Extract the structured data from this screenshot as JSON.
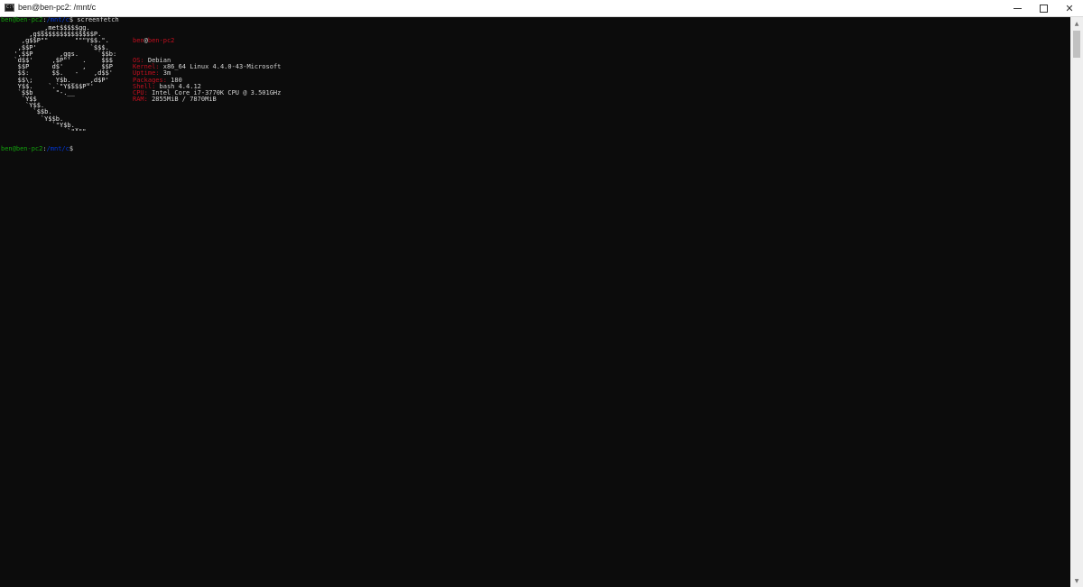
{
  "window": {
    "title": "ben@ben-pc2: /mnt/c",
    "icon": "console-icon",
    "icon_glyph": "C:\\",
    "controls": {
      "minimize_icon": "minimize-icon",
      "maximize_icon": "maximize-icon",
      "close_icon": "close-icon",
      "close_glyph": "✕"
    }
  },
  "colors": {
    "prompt_user": "#13a10e",
    "prompt_path": "#0037da",
    "label": "#c50f1f",
    "logo": "#e8e8e8",
    "logo_accent": "#c50f1f",
    "text": "#c0c0c0",
    "background": "#0c0c0c"
  },
  "prompt1": {
    "user_host": "ben@ben-pc2",
    "colon": ":",
    "path": "/mnt/c",
    "symbol": "$",
    "command": " screenfetch"
  },
  "logo": [
    "         _,met$$$$$gg.",
    "      ,g$$$$$$$$$$$$$$$P.",
    "    ,g$$P\"\"       \"\"\"Y$$.\".",
    "   ,$$P'              `$$$.",
    "  ',$$P       ,ggs.     `$$b:",
    "  `d$$'     ,$P\"'   .    $$$",
    "   $$P      d$'     ,    $$P",
    "   $$:      $$.   -    ,d$$'",
    "   $$\\;      Y$b._   _,d$P'",
    "   Y$$.    `.`\"Y$$$$P\"'",
    "   `$$b      \"-.__",
    "    `Y$$",
    "     `Y$$.",
    "       `$$b.",
    "         `Y$$b.",
    "            `\"Y$b._",
    "                `\"\"\"\""
  ],
  "info": {
    "header_user": "ben",
    "header_at": "@",
    "header_host": "ben-pc2",
    "rows": [
      {
        "label": "OS:",
        "value": " Debian"
      },
      {
        "label": "Kernel:",
        "value": " x86_64 Linux 4.4.0-43-Microsoft"
      },
      {
        "label": "Uptime:",
        "value": " 3m"
      },
      {
        "label": "Packages:",
        "value": " 180"
      },
      {
        "label": "Shell:",
        "value": " bash 4.4.12"
      },
      {
        "label": "CPU:",
        "value": " Intel Core i7-3770K CPU @ 3.501GHz"
      },
      {
        "label": "RAM:",
        "value": " 2855MiB / 7870MiB"
      }
    ]
  },
  "prompt2": {
    "user_host": "ben@ben-pc2",
    "colon": ":",
    "path": "/mnt/c",
    "symbol": "$"
  },
  "scrollbar": {
    "up_icon": "scroll-up-arrow-icon",
    "down_icon": "scroll-down-arrow-icon",
    "up_glyph": "▲",
    "down_glyph": "▼"
  }
}
